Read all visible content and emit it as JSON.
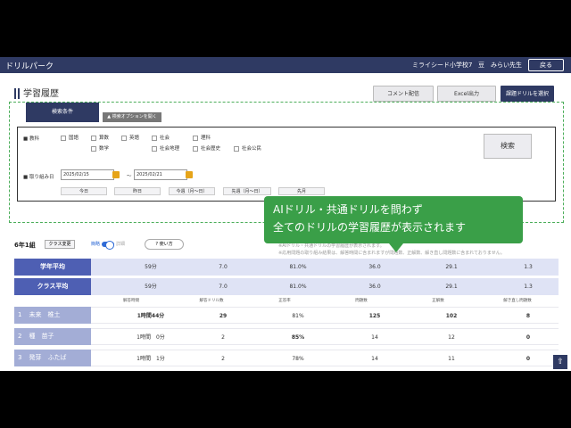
{
  "appbar": {
    "title": "ドリルパーク",
    "school": "ミライシード小学校7",
    "teacher_icon": "豆",
    "teacher": "みらい先生",
    "back": "戻る"
  },
  "page": {
    "title": "学習履歴"
  },
  "toolbar": {
    "comment": "コメント配信",
    "excel": "Excel出力",
    "assign": "課題ドリルを選択"
  },
  "tabs": {
    "conditions": "検索条件",
    "options": "▲ 検索オプションを開く"
  },
  "search": {
    "subject_label": "■ 教科",
    "subjects_row1": [
      "国語",
      "算数",
      "英語",
      "社会",
      "理科"
    ],
    "subjects_row2": [
      "数学",
      "社会地理",
      "社会歴史",
      "社会公民"
    ],
    "date_label": "■ 取り組み日",
    "date_from": "2025/02/15",
    "date_to": "2025/02/21",
    "tilde": "〜",
    "quick": [
      "今日",
      "昨日",
      "今週（月〜日）",
      "先週（月〜日）",
      "先月"
    ],
    "button": "検索"
  },
  "callout": {
    "line1": "AIドリル・共通ドリルを問わず",
    "line2": "全てのドリルの学習履歴が表示されます"
  },
  "class": {
    "name": "6年1組",
    "change": "クラス変更",
    "toggle_on": "簡略",
    "toggle_off": "詳細",
    "help": "使い方"
  },
  "notes": {
    "n1": "※AIドリル・共通ドリルの学習履歴が表示されます。",
    "n2": "※応用問題の取り組み結果は、解答時間に含まれますが問題数、正解数、解き直し問題数に含まれておりません。"
  },
  "columns": [
    "解答時間",
    "解答ドリル数",
    "正答率",
    "問題数",
    "正解数",
    "解き直し問題数"
  ],
  "summary": [
    {
      "label": "学年平均",
      "values": [
        "59分",
        "7.0",
        "81.0%",
        "36.0",
        "29.1",
        "1.3"
      ]
    },
    {
      "label": "クラス平均",
      "values": [
        "59分",
        "7.0",
        "81.0%",
        "36.0",
        "29.1",
        "1.3"
      ]
    }
  ],
  "students": [
    {
      "no": "1",
      "name": "未来　椎土",
      "values": [
        "1時間44分",
        "29",
        "81%",
        "125",
        "102",
        "8"
      ],
      "hl": [
        true,
        true,
        false,
        true,
        true,
        true
      ]
    },
    {
      "no": "2",
      "name": "種　苗子",
      "values": [
        "1時間　0分",
        "2",
        "85%",
        "14",
        "12",
        "0"
      ],
      "hl": [
        false,
        false,
        true,
        false,
        false,
        false
      ]
    },
    {
      "no": "3",
      "name": "発芽　ふたば",
      "values": [
        "1時間　1分",
        "2",
        "78%",
        "14",
        "11",
        "0"
      ],
      "hl": [
        false,
        false,
        false,
        false,
        false,
        false
      ]
    }
  ],
  "colors": {
    "navy": "#2f3a63",
    "green": "#3a9f48",
    "highlight_green": "#3aa646",
    "red": "#e04040"
  }
}
